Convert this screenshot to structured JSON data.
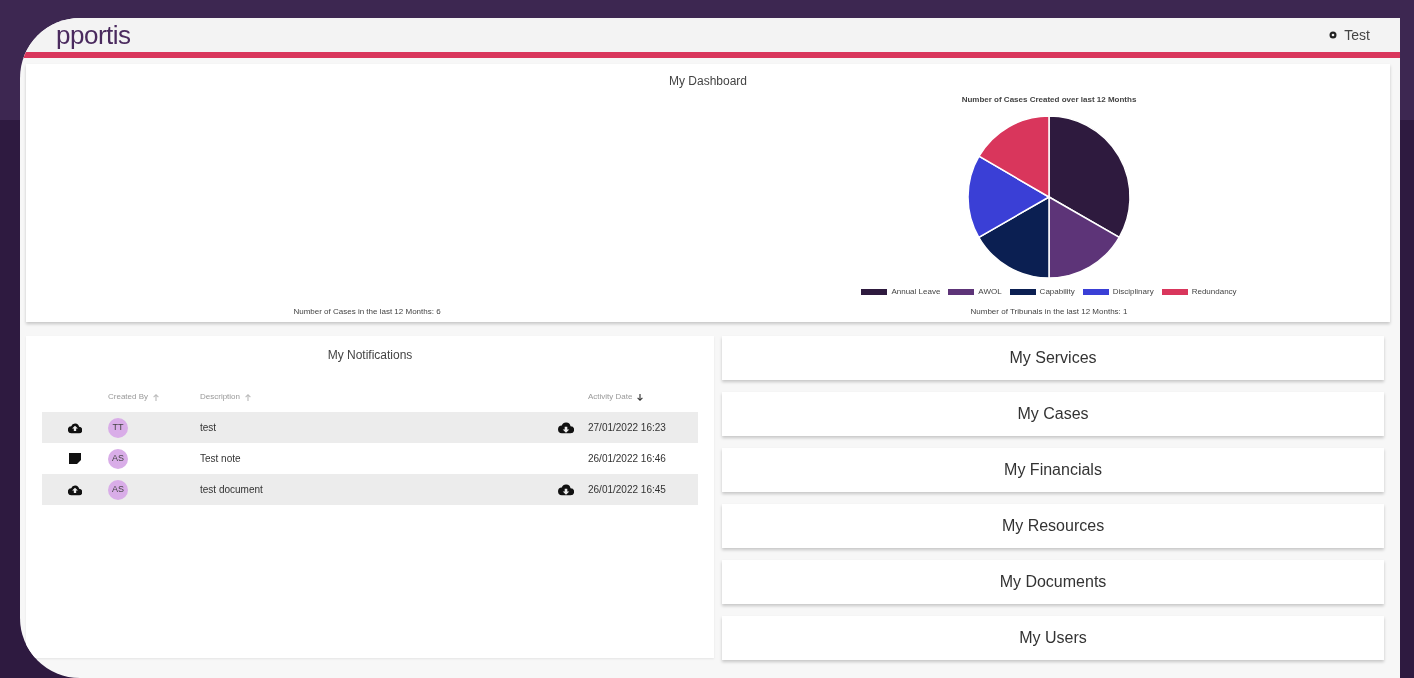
{
  "header": {
    "logo": "pportis",
    "user": "Test"
  },
  "dashboard": {
    "title": "My Dashboard",
    "cases_note": "Number of Cases in the last 12 Months: 6",
    "tribunals_note": "Number of Tribunals in the last 12 Months: 1",
    "chart_data": {
      "type": "pie",
      "title": "Number of Cases Created over last 12 Months",
      "categories": [
        "Annual Leave",
        "AWOL",
        "Capability",
        "Disciplinary",
        "Redundancy"
      ],
      "values": [
        33.3,
        16.7,
        16.7,
        16.7,
        16.6
      ],
      "colors": [
        "#2e1a3e",
        "#5d3478",
        "#0b1f52",
        "#3a3fd6",
        "#d9365c"
      ],
      "legend": "bottom"
    }
  },
  "notifications": {
    "title": "My Notifications",
    "columns": [
      {
        "label": "Created By",
        "sorted": false
      },
      {
        "label": "Description",
        "sorted": false
      },
      {
        "label": "Activity Date",
        "sorted": true
      }
    ],
    "rows": [
      {
        "kind": "upload",
        "initials": "TT",
        "description": "test",
        "download": true,
        "date": "27/01/2022 16:23"
      },
      {
        "kind": "note",
        "initials": "AS",
        "description": "Test note",
        "download": false,
        "date": "26/01/2022 16:46"
      },
      {
        "kind": "upload",
        "initials": "AS",
        "description": "test document",
        "download": true,
        "date": "26/01/2022 16:45"
      }
    ]
  },
  "menu": [
    "My Services",
    "My Cases",
    "My Financials",
    "My Resources",
    "My Documents",
    "My Users"
  ]
}
